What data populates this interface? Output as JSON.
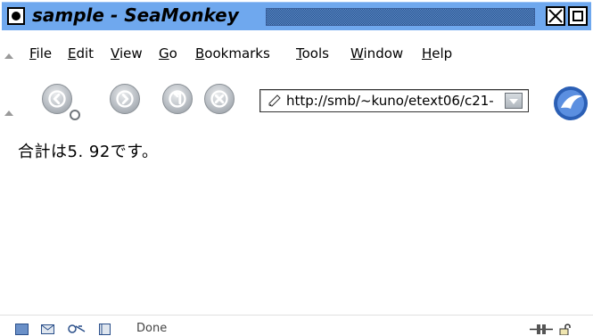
{
  "window": {
    "title": "sample - SeaMonkey"
  },
  "menubar": {
    "items": [
      {
        "label": "File",
        "key": "F",
        "rest": "ile"
      },
      {
        "label": "Edit",
        "key": "E",
        "rest": "dit"
      },
      {
        "label": "View",
        "key": "V",
        "rest": "iew"
      },
      {
        "label": "Go",
        "key": "G",
        "rest": "o"
      },
      {
        "label": "Bookmarks",
        "key": "B",
        "rest": "ookmarks"
      },
      {
        "label": "Tools",
        "key": "T",
        "rest": "ools"
      },
      {
        "label": "Window",
        "key": "W",
        "rest": "indow"
      },
      {
        "label": "Help",
        "key": "H",
        "rest": "elp"
      }
    ]
  },
  "toolbar": {
    "buttons": [
      "back-icon",
      "forward-icon",
      "reload-icon",
      "stop-icon"
    ],
    "url": "http://smb/~kuno/etext06/c21-"
  },
  "content": {
    "text": "合計は5. 92です。"
  },
  "statusbar": {
    "text": "Done",
    "icons": [
      "navigator-icon",
      "mail-icon",
      "composer-icon",
      "address-book-icon",
      "online-icon",
      "security-lock-icon"
    ]
  },
  "colors": {
    "titlebar": "#6fa8ee",
    "accent_blue": "#2b5fb5"
  }
}
